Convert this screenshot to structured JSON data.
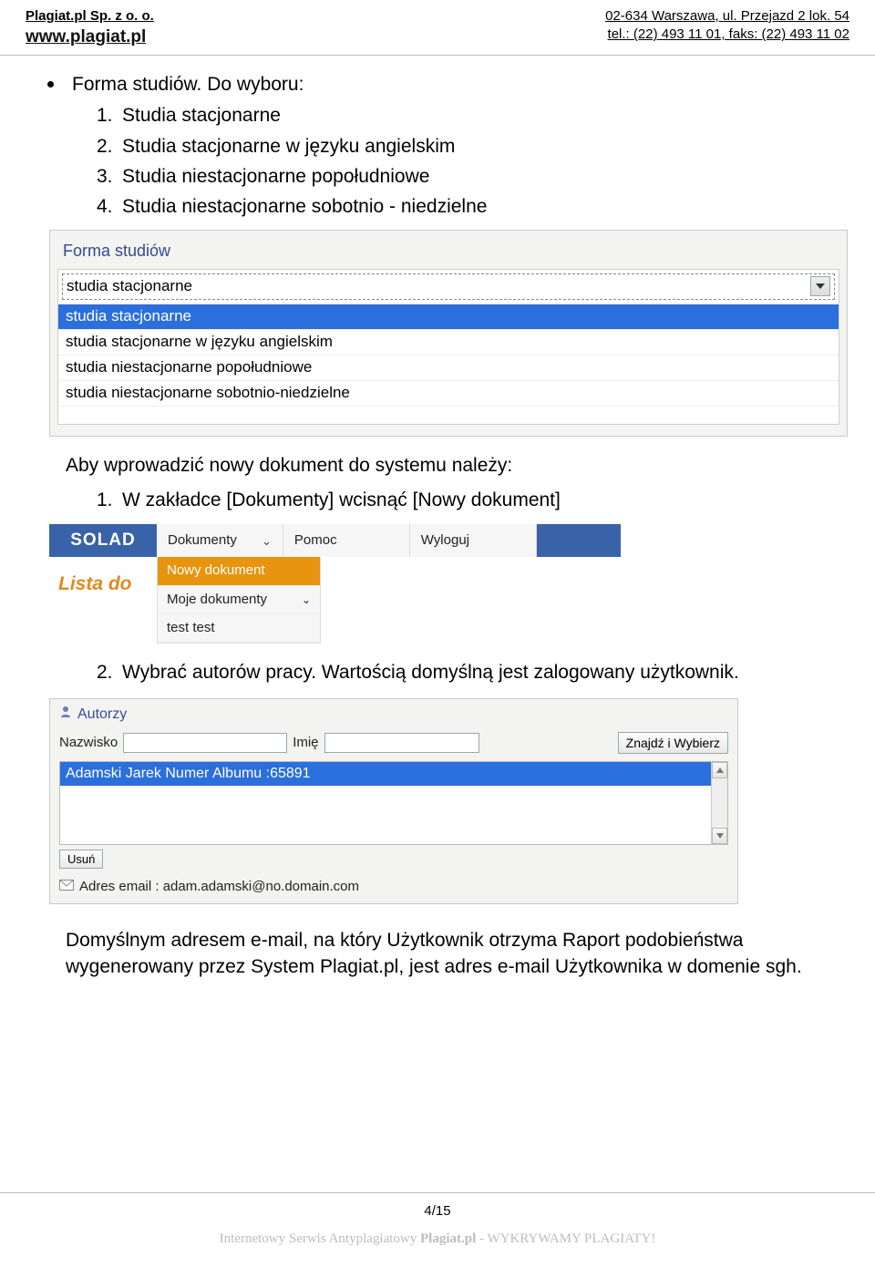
{
  "header": {
    "company": "Plagiat.pl Sp. z o. o.",
    "website": "www.plagiat.pl",
    "address": "02-634 Warszawa, ul. Przejazd 2 lok. 54",
    "phone": "tel.: (22) 493 11 01, faks: (22)  493 11 02"
  },
  "bullet_heading": "Forma studiów. Do wyboru:",
  "form_options_numbered": [
    "Studia stacjonarne",
    "Studia stacjonarne w języku angielskim",
    "Studia niestacjonarne popołudniowe",
    "Studia niestacjonarne sobotnio - niedzielne"
  ],
  "shot1": {
    "title": "Forma studiów",
    "selected": "studia stacjonarne",
    "options": [
      {
        "label": "studia stacjonarne",
        "highlighted": true
      },
      {
        "label": "studia stacjonarne w języku angielskim",
        "highlighted": false
      },
      {
        "label": "studia niestacjonarne popołudniowe",
        "highlighted": false
      },
      {
        "label": "studia niestacjonarne sobotnio-niedzielne",
        "highlighted": false
      }
    ]
  },
  "intro_para": "Aby wprowadzić nowy dokument do systemu należy:",
  "step1": "W zakładce [Dokumenty] wcisnąć [Nowy dokument]",
  "shot2": {
    "logo": "SOLAD",
    "nav": [
      {
        "label": "Dokumenty",
        "chevron": true
      },
      {
        "label": "Pomoc",
        "chevron": false
      },
      {
        "label": "Wyloguj",
        "chevron": false
      }
    ],
    "side_label": "Lista do",
    "menu": [
      {
        "label": "Nowy dokument",
        "highlighted": true,
        "chevron": false
      },
      {
        "label": "Moje dokumenty",
        "highlighted": false,
        "chevron": true
      },
      {
        "label": "test test",
        "highlighted": false,
        "chevron": false
      }
    ]
  },
  "step2": "Wybrać autorów pracy. Wartością domyślną jest zalogowany użytkownik.",
  "shot3": {
    "heading": "Autorzy",
    "label_nazwisko": "Nazwisko",
    "label_imie": "Imię",
    "btn_find": "Znajdź i Wybierz",
    "selected_author": "Adamski Jarek Numer Albumu :65891",
    "btn_delete": "Usuń",
    "mail_label": "Adres email : adam.adamski@no.domain.com"
  },
  "closing_para": "Domyślnym adresem e-mail, na który Użytkownik otrzyma Raport podobieństwa wygenerowany przez System Plagiat.pl, jest adres e-mail Użytkownika w domenie sgh.",
  "footer": {
    "page": "4/15",
    "tag_prefix": "Internetowy Serwis Antyplagiatowy ",
    "tag_bold": "Plagiat.pl",
    "tag_suffix": " - WYKRYWAMY PLAGIATY!"
  }
}
